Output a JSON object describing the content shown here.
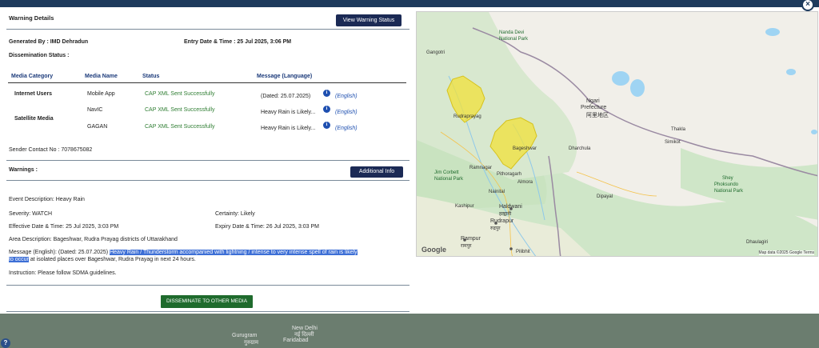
{
  "modal": {
    "section_title": "Warning Details",
    "view_status_button": "View Warning Status",
    "generated_by": "Generated By : IMD Dehradun",
    "entry_datetime": "Entry Date & Time : 25 Jul 2025, 3:06 PM",
    "dissemination_status": "Dissemination Status :",
    "table": {
      "headers": [
        "Media Category",
        "Media Name",
        "Status",
        "Message (Language)"
      ],
      "categories": [
        "Internet Users",
        "Satellite Media"
      ],
      "rows": [
        {
          "media_name": "Mobile App",
          "status": "CAP XML Sent Successfully",
          "message": "(Dated: 25.07.2025)",
          "language": "(English)"
        },
        {
          "media_name": "NavIC",
          "status": "CAP XML Sent Successfully",
          "message": "Heavy Rain is Likely...",
          "language": "(English)"
        },
        {
          "media_name": "GAGAN",
          "status": "CAP XML Sent Successfully",
          "message": "Heavy Rain is Likely...",
          "language": "(English)"
        }
      ],
      "info_icon": "info-icon"
    },
    "sender_contact": "Sender Contact No : 7078675082",
    "warnings_label": "Warnings :",
    "additional_info_button": "Additional Info",
    "event_description": "Event Description: Heavy Rain",
    "severity": "Severity: WATCH",
    "certainty": "Certainty: Likely",
    "effective": "Effective Date & Time: 25 Jul 2025, 3:03 PM",
    "expiry": "Expiry Date & Time: 26 Jul 2025, 3:03 PM",
    "area": "Area Description: Bageshwar, Rudra Prayag districts of Uttarakhand",
    "message_prefix": "Message (English): (Dated: 25.07.2025) ",
    "message_highlight_1": "Heavy Rain / Thunderstorm accompanied with lightning / intense to very intense spell of rain is likely",
    "message_highlight_2": "to occur",
    "message_rest": " at isolated places over Bageshwar, Rudra Prayag in next 24 hours.",
    "instruction": "Instruction: Please follow SDMA guidelines.",
    "disseminate_button": "DISSEMINATE TO OTHER MEDIA"
  },
  "map": {
    "labels": [
      "Gangotri",
      "Nanda Devi",
      "National Park",
      "Ngari",
      "Prefecture",
      "阿里地区",
      "Rudraprayag",
      "Bageshwar",
      "Dharchula",
      "Jim Corbett",
      "National Park",
      "Haldwani",
      "हल्द्वानी",
      "Rudrapur",
      "रुद्रपुर",
      "Rampur",
      "रामपुर",
      "Pilibhit",
      "Shey",
      "Phoksundo",
      "National Park",
      "Dhaulagiri",
      "Kashipur",
      "Pithoragarh",
      "Ramnagar",
      "Nainital",
      "Almora",
      "Dipayal",
      "Simikot",
      "Thakla"
    ],
    "google": "Google",
    "attribution": "Map data ©2025 Google   Terms"
  },
  "background": {
    "labels": [
      "Gurugram",
      "गुरुग्राम",
      "Faridabad",
      "New Delhi",
      "नई दिल्ली"
    ],
    "help": "?",
    "close": "×"
  },
  "colors": {
    "navy_button": "#1b2a55",
    "green_button": "#1f6b2d",
    "status_green": "#2e7d32",
    "header_blue": "#1b3a7a",
    "highlight": "#3d6fd6",
    "warning_yellow": "#f2e23a"
  }
}
